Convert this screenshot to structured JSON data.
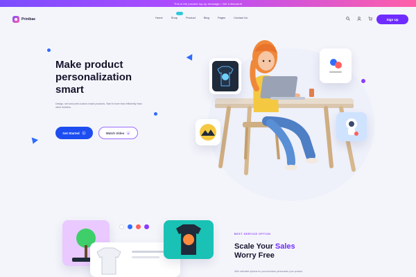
{
  "promo": {
    "text": "This is the product top-up message • Get a discount!"
  },
  "brand": {
    "name": "Printbae"
  },
  "nav": {
    "items": [
      {
        "label": "Home"
      },
      {
        "label": "Shop"
      },
      {
        "label": "Product"
      },
      {
        "label": "Blog"
      },
      {
        "label": "Pages"
      },
      {
        "label": "Contact Us"
      }
    ],
    "signup_label": "Sign Up"
  },
  "hero": {
    "title": "Make product\npersonalization\nsmart",
    "description": "Design, sell and print custom-made products. Start it more than efficiently than other builders.",
    "primary_cta": "Get Started",
    "secondary_cta": "Watch Video"
  },
  "features": {
    "label": "BEST SERVICE OPTION",
    "title_pre": "Scale Your ",
    "title_highlight": "Sales",
    "title_post": "Worry Free",
    "description": "With unlimited options for your business personalize your product."
  },
  "colors": {
    "accent_purple": "#6f2cff",
    "accent_blue": "#1d4df0",
    "promo_gradient_start": "#7b4dff",
    "promo_gradient_end": "#ff5fa8"
  },
  "icons": {
    "search": "search-icon",
    "user": "user-icon",
    "cart": "cart-icon"
  }
}
